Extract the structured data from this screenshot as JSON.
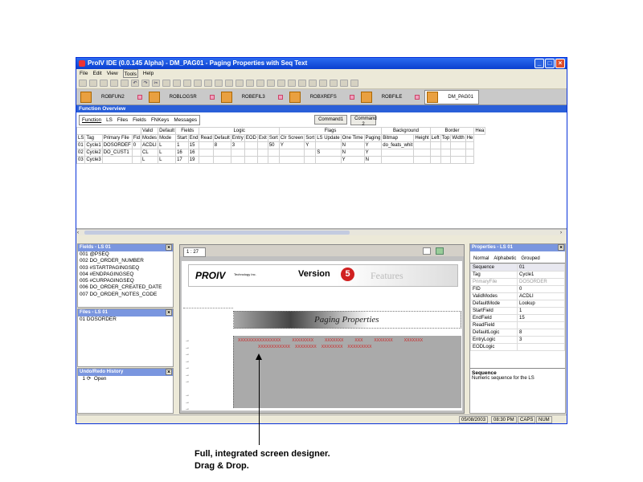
{
  "window": {
    "title": "ProIV IDE (0.0.145 Alpha) - DM_PAG01 - Paging Properties with Seq Text",
    "menu": [
      "File",
      "Edit",
      "View",
      "Tools",
      "Help"
    ],
    "doc_tabs": [
      "ROBFUN2",
      "ROBLOGSR",
      "ROBEFIL3",
      "ROBXREFS",
      "ROBFILE",
      "DM_PAG01"
    ]
  },
  "function_overview": {
    "title": "Function Overview",
    "tabs": [
      "Function",
      "LS",
      "Files",
      "Fields",
      "FNKeys",
      "Messages"
    ],
    "command1": "Command1",
    "command2": "Command 2",
    "group_headers": [
      "Valid",
      "Default",
      "Fields",
      "Logic",
      "Flags",
      "Background",
      "Border",
      "Hea"
    ],
    "columns": [
      "LS",
      "Tag",
      "Primary File",
      "Fid",
      "Modes",
      "Mode",
      "Start",
      "End",
      "Read",
      "Default",
      "Entry",
      "EOD",
      "Exit",
      "Sort",
      "Clr Screen",
      "Sort",
      "LS Update",
      "One Time",
      "Paging",
      "Bitmap",
      "Height",
      "Left",
      "Top",
      "Width",
      "He"
    ],
    "rows": [
      [
        "01",
        "Cycle1",
        "DOSORDEF",
        "0",
        "ACDLI",
        "L",
        "1",
        "15",
        "",
        "8",
        "3",
        "",
        "",
        "50",
        "Y",
        "Y",
        "",
        "N",
        "Y",
        "do_feats_whit",
        "",
        "",
        "",
        "",
        ""
      ],
      [
        "02",
        "Cycle2",
        "DO_CUST1",
        "",
        "CL",
        "L",
        "16",
        "16",
        "",
        "",
        "",
        "",
        "",
        "",
        "",
        "",
        "S",
        "N",
        "Y",
        "",
        "",
        "",
        "",
        "",
        ""
      ],
      [
        "03",
        "Cycle3",
        "",
        "",
        "L",
        "L",
        "17",
        "19",
        "",
        "",
        "",
        "",
        "",
        "",
        "",
        "",
        "",
        "Y",
        "N",
        "",
        "",
        "",
        "",
        "",
        ""
      ]
    ]
  },
  "fields_panel": {
    "title": "Fields - LS 01",
    "items": [
      "001 @PSEQ",
      "002 DO_ORDER_NUMBER",
      "003 #STARTPAGINGSEQ",
      "004 #ENDPAGINGSEQ",
      "005 #CURPAGINGSEQ",
      "006 DO_ORDER_CREATED_DATE",
      "007 DO_ORDER_NOTES_CODE"
    ]
  },
  "files_panel": {
    "title": "Files - LS 01",
    "items": [
      "01 DOSORDER"
    ]
  },
  "undo_panel": {
    "title": "Undo/Redo History",
    "items": [
      "Open"
    ]
  },
  "designer": {
    "position": "1 : 27",
    "logo_text": "PROIV",
    "logo_sub": "Technology Inc.",
    "version_text": "Version",
    "version_num": "5",
    "features_text": "Features",
    "paging_title": "Paging Properties",
    "xrow1": [
      "XXXXXXXXXXXXXXXX",
      "XXXXXXXX",
      "XXXXXXX",
      "XXX",
      "XXXXXXX",
      "XXXXXXX"
    ],
    "xrow2": [
      "XXXXXXXXXXXX",
      "XXXXXXXX",
      "XXXXXXXX",
      "XXXXXXXXX"
    ]
  },
  "properties": {
    "title": "Properties - LS 01",
    "tabs": [
      "Normal",
      "Alphabetic",
      "Grouped"
    ],
    "rows": [
      [
        "Sequence",
        "01"
      ],
      [
        "Tag",
        "Cycle1"
      ],
      [
        "PrimaryFile",
        "DOSORDER"
      ],
      [
        "FID",
        "0"
      ],
      [
        "ValidModes",
        "ACDLI"
      ],
      [
        "DefaultMode",
        "Lookup"
      ],
      [
        "StartField",
        "1"
      ],
      [
        "EndField",
        "15"
      ],
      [
        "ReadField",
        ""
      ],
      [
        "DefaultLogic",
        "8"
      ],
      [
        "EntryLogic",
        "3"
      ],
      [
        "EODLogic",
        ""
      ]
    ],
    "desc_title": "Sequence",
    "desc_text": "Numeric sequence for the LS"
  },
  "status": {
    "date": "05/08/2003",
    "time": "08:30 PM",
    "caps": "CAPS",
    "num": "NUM"
  },
  "caption": {
    "line1": "Full, integrated screen designer.",
    "line2": "Drag & Drop."
  }
}
